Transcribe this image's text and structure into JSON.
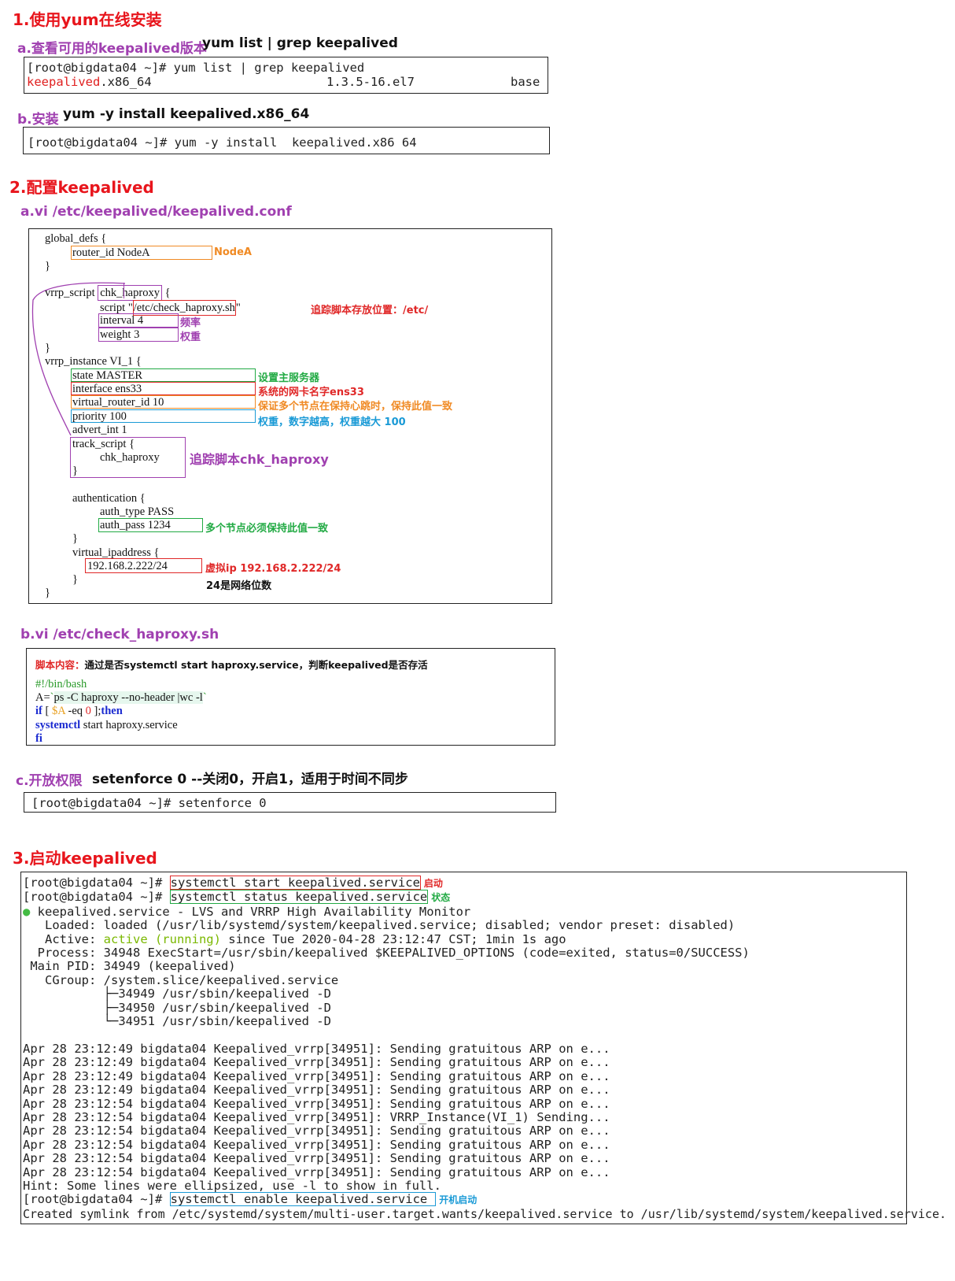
{
  "section1": {
    "title": "1.使用yum在线安装",
    "a_label": "a.查看可用的keepalived版本",
    "a_cmd": "yum list | grep keepalived",
    "a_term": {
      "line1": "[root@bigdata04 ~]# yum list | grep keepalived",
      "pkg_name": "keepalived",
      "pkg_arch": ".x86_64",
      "pkg_version": "1.3.5-16.el7",
      "pkg_repo": "base"
    },
    "b_label": "b.安装",
    "b_cmd": "yum -y install  keepalived.x86_64",
    "b_term": "[root@bigdata04 ~]# yum -y install  keepalived.x86 64"
  },
  "section2": {
    "title": "2.配置keepalived",
    "a_label": "a.vi /etc/keepalived/keepalived.conf",
    "conf": {
      "l_global": "global_defs {",
      "l_router": "router_id NodeA",
      "l_close1": "}",
      "l_vrrp_script": "vrrp_script ",
      "l_chk": "chk_haproxy",
      "l_brace": " {",
      "l_script_kw": "script \"",
      "l_script_path": "/etc/check_haproxy.sh",
      "l_script_end": "\"",
      "l_interval": "interval 4",
      "l_weight": "weight 3",
      "l_close2": "}",
      "l_vrrp_inst": "vrrp_instance VI_1 {",
      "l_state": "state MASTER",
      "l_iface": "interface ens33",
      "l_vrid": "virtual_router_id 10",
      "l_prio": "priority 100",
      "l_advert": "advert_int 1",
      "l_track": "track_script {",
      "l_track_chk": "chk_haproxy",
      "l_track_close": "}",
      "l_auth": "authentication {",
      "l_auth_type": "auth_type PASS",
      "l_auth_pass": "auth_pass 1234",
      "l_auth_close": "}",
      "l_vip": "virtual_ipaddress {",
      "l_vip_addr": "192.168.2.222/24",
      "l_vip_close": "}",
      "l_close3": "}"
    },
    "notes": {
      "nodea": "NodeA",
      "script_loc": "追踪脚本存放位置：/etc/",
      "freq": "频率",
      "weight": "权重",
      "master": "设置主服务器",
      "iface": "系统的网卡名字ens33",
      "vrid": "保证多个节点在保持心跳时，保持此值一致",
      "prio": "权重，数字越高，权重越大 100",
      "track": "追踪脚本chk_haproxy",
      "auth": "多个节点必须保持此值一致",
      "vip": "虚拟ip 192.168.2.222/24",
      "mask": "24是网络位数"
    },
    "b_label": "b.vi /etc/check_haproxy.sh",
    "script": {
      "desc_red": "脚本内容：",
      "desc_black": "通过是否systemctl start haproxy.service，判断keepalived是否存活",
      "shebang": "#!/bin/bash",
      "a_var": "A=",
      "a_bt1": "`",
      "a_cmd": "ps -C haproxy --no-header |wc -l",
      "a_bt2": "`",
      "if_kw": "if",
      "if_b1": " [ ",
      "if_var": "$A",
      "if_eq": " -eq ",
      "if_zero": "0",
      "if_b2": " ];",
      "if_then": "then",
      "sysctl_kw": "systemctl",
      "sysctl_rest": " start haproxy.service",
      "fi": "fi"
    },
    "c_label": "c.开放权限",
    "c_cmd": "setenforce 0  --关闭0，开启1，适用于时间不同步",
    "c_term": "[root@bigdata04 ~]# setenforce 0"
  },
  "section3": {
    "title": "3.启动keepalived",
    "prompt": "[root@bigdata04 ~]# ",
    "cmd_start": "systemctl start keepalived.service",
    "note_start": "启动",
    "cmd_status": "systemctl status keepalived.service",
    "note_status": "状态",
    "svc_line": " keepalived.service - LVS and VRRP High Availability Monitor",
    "loaded": "   Loaded: loaded (/usr/lib/systemd/system/keepalived.service; disabled; vendor preset: disabled)",
    "active_pre": "   Active: ",
    "active_state": "active (running)",
    "active_post": " since Tue 2020-04-28 23:12:47 CST; 1min 1s ago",
    "process": "  Process: 34948 ExecStart=/usr/sbin/keepalived $KEEPALIVED_OPTIONS (code=exited, status=0/SUCCESS)",
    "mainpid": " Main PID: 34949 (keepalived)",
    "cgroup": "   CGroup: /system.slice/keepalived.service",
    "cg1": "           ├─34949 /usr/sbin/keepalived -D",
    "cg2": "           ├─34950 /usr/sbin/keepalived -D",
    "cg3": "           └─34951 /usr/sbin/keepalived -D",
    "logs": [
      "Apr 28 23:12:49 bigdata04 Keepalived_vrrp[34951]: Sending gratuitous ARP on e...",
      "Apr 28 23:12:49 bigdata04 Keepalived_vrrp[34951]: Sending gratuitous ARP on e...",
      "Apr 28 23:12:49 bigdata04 Keepalived_vrrp[34951]: Sending gratuitous ARP on e...",
      "Apr 28 23:12:49 bigdata04 Keepalived_vrrp[34951]: Sending gratuitous ARP on e...",
      "Apr 28 23:12:54 bigdata04 Keepalived_vrrp[34951]: Sending gratuitous ARP on e...",
      "Apr 28 23:12:54 bigdata04 Keepalived_vrrp[34951]: VRRP_Instance(VI_1) Sending...",
      "Apr 28 23:12:54 bigdata04 Keepalived_vrrp[34951]: Sending gratuitous ARP on e...",
      "Apr 28 23:12:54 bigdata04 Keepalived_vrrp[34951]: Sending gratuitous ARP on e...",
      "Apr 28 23:12:54 bigdata04 Keepalived_vrrp[34951]: Sending gratuitous ARP on e...",
      "Apr 28 23:12:54 bigdata04 Keepalived_vrrp[34951]: Sending gratuitous ARP on e..."
    ],
    "hint": "Hint: Some lines were ellipsized, use -l to show in full.",
    "cmd_enable": "systemctl enable keepalived.service",
    "note_enable": "开机启动",
    "symlink": "Created symlink from /etc/systemd/system/multi-user.target.wants/keepalived.service to /usr/lib/systemd/system/keepalived.service."
  },
  "colors": {
    "title_red": "#e8151c",
    "label_purple": "#a040b0",
    "hl_orange": "#f08a24",
    "hl_red": "#e02828",
    "hl_green": "#22aa44",
    "hl_blue": "#1a9ad6",
    "hl_purple": "#a040b0",
    "active_green": "#7ab800"
  }
}
